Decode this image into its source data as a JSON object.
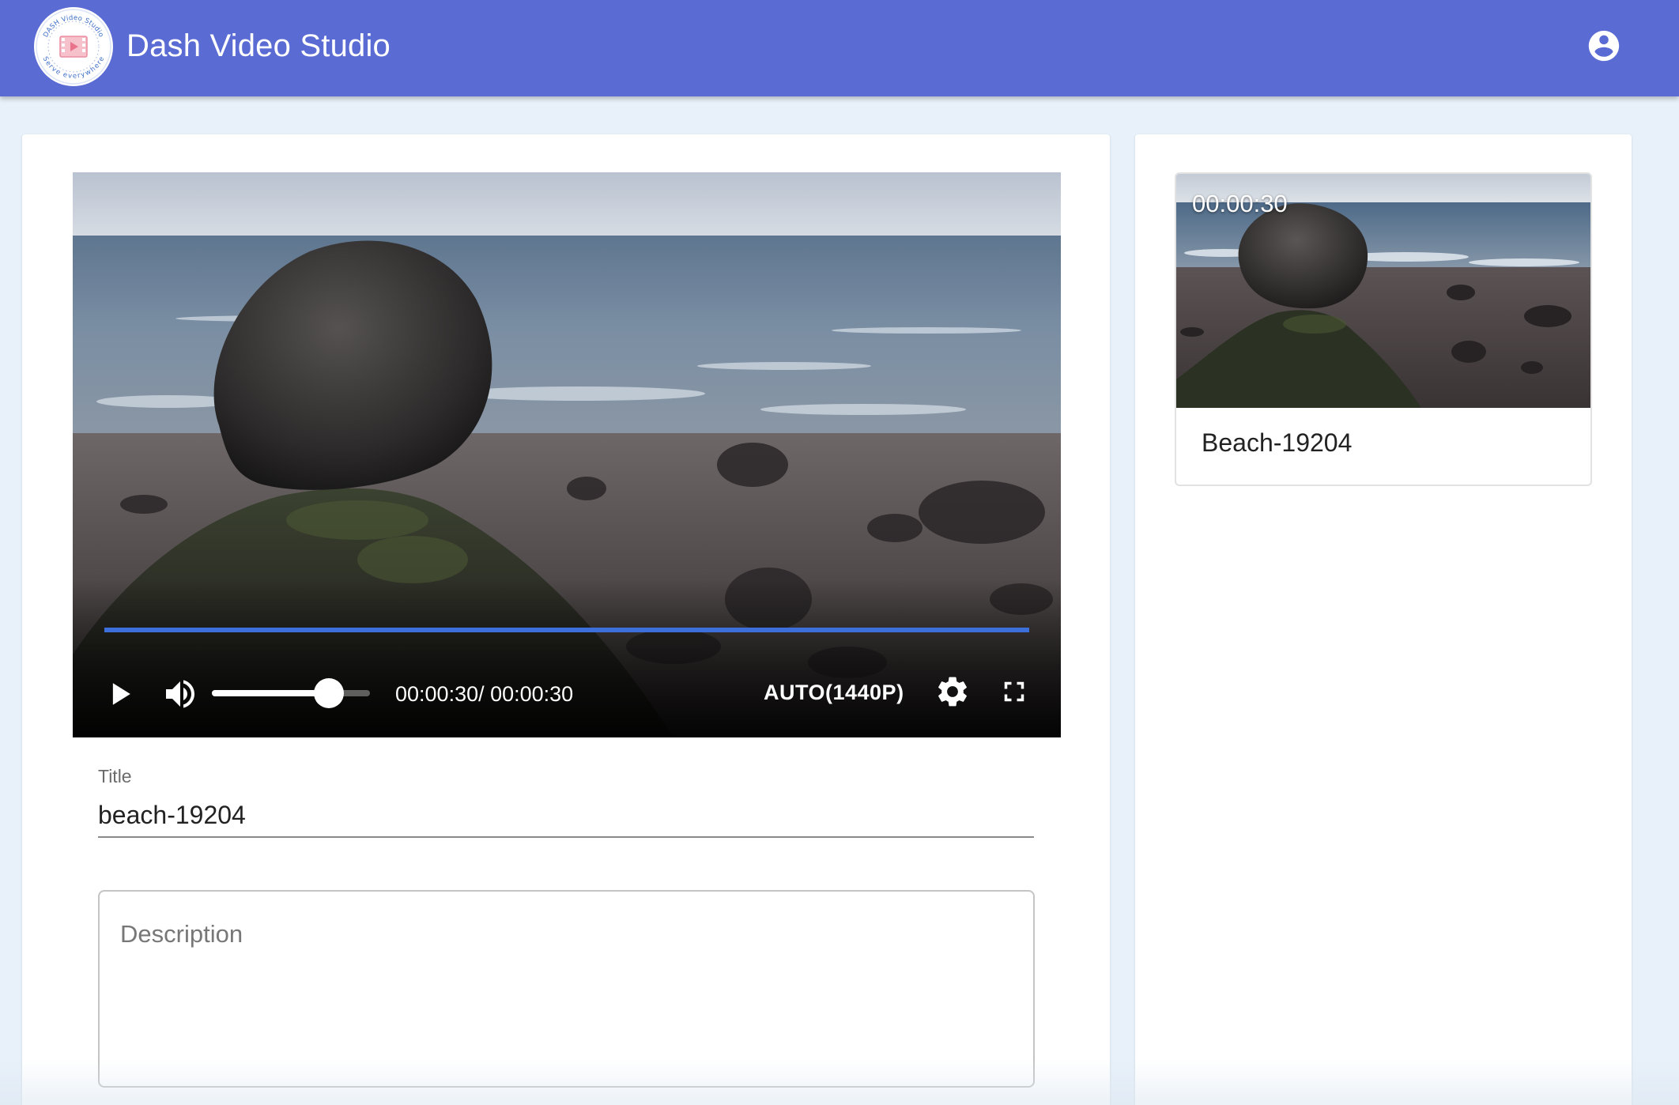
{
  "app": {
    "title": "Dash Video Studio",
    "logo_icon": "film-play-icon",
    "logo_top_text": "DASH Video Studio",
    "logo_bottom_text": "Serve everywhere",
    "account_icon": "account-circle-icon",
    "header_color": "#5b6bd4",
    "background_color": "#e8f1fa"
  },
  "player": {
    "current_time": "00:00:30",
    "duration": "00:00:30",
    "time_display": "00:00:30/ 00:00:30",
    "progress": 1.0,
    "volume": 0.74,
    "quality": "AUTO(1440P)",
    "progress_color": "#3c6fd9",
    "icons": {
      "play": "play-icon",
      "volume": "volume-up-icon",
      "settings": "gear-icon",
      "fullscreen": "fullscreen-icon"
    }
  },
  "form": {
    "title_label": "Title",
    "title_value": "beach-19204",
    "description_placeholder": "Description",
    "description_value": ""
  },
  "video_list": [
    {
      "duration": "00:00:30",
      "title": "Beach-19204"
    }
  ]
}
